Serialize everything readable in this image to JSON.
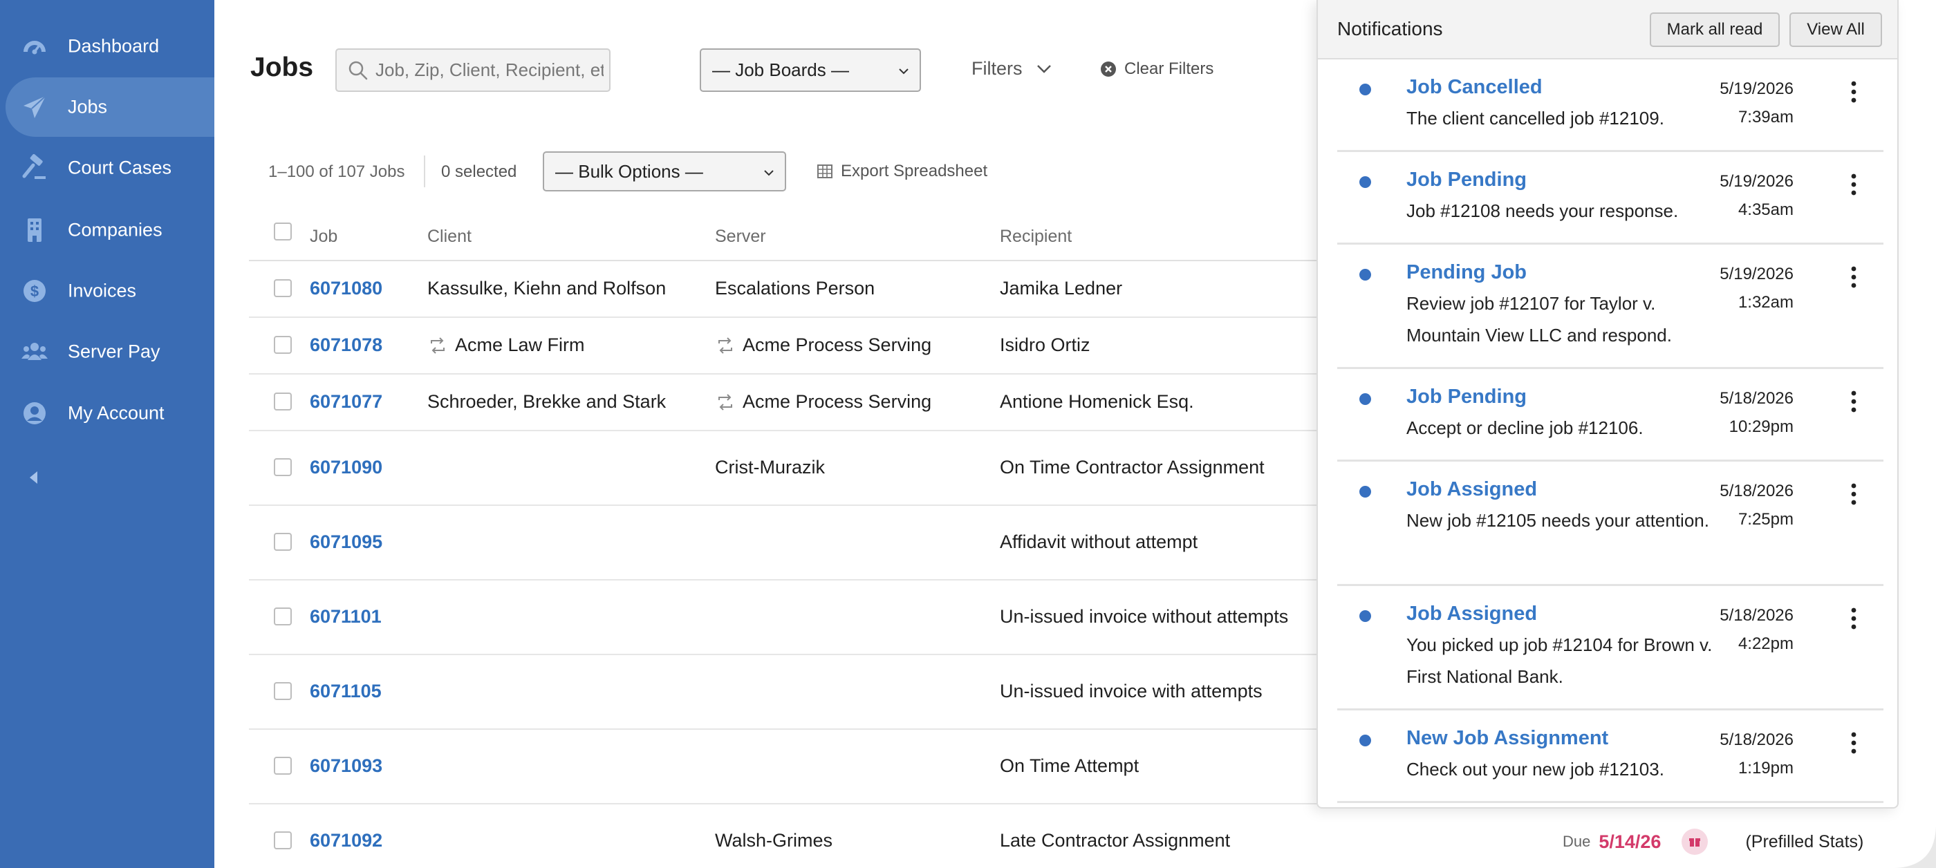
{
  "sidebar": {
    "items": [
      {
        "label": "Dashboard",
        "icon": "dashboard-gauge-icon",
        "active": false
      },
      {
        "label": "Jobs",
        "icon": "paper-plane-icon",
        "active": true
      },
      {
        "label": "Court Cases",
        "icon": "gavel-icon",
        "active": false
      },
      {
        "label": "Companies",
        "icon": "building-icon",
        "active": false
      },
      {
        "label": "Invoices",
        "icon": "dollar-coin-icon",
        "active": false
      },
      {
        "label": "Server Pay",
        "icon": "users-group-icon",
        "active": false
      },
      {
        "label": "My Account",
        "icon": "user-circle-icon",
        "active": false
      }
    ],
    "collapse_icon": "caret-left-icon"
  },
  "header": {
    "title": "Jobs",
    "search_placeholder": "Job, Zip, Client, Recipient, etc.",
    "job_boards_label": "— Job Boards —",
    "filters_label": "Filters",
    "clear_filters_label": "Clear Filters"
  },
  "toolbar": {
    "job_count": "1–100 of 107 Jobs",
    "selected_count": "0 selected",
    "bulk_options_label": "— Bulk Options —",
    "export_label": "Export Spreadsheet"
  },
  "table": {
    "columns": [
      "Job",
      "Client",
      "Server",
      "Recipient"
    ],
    "rows": [
      {
        "job": "6071080",
        "client": "Kassulke, Kiehn and Rolfson",
        "client_repeat": false,
        "server": "Escalations Person",
        "server_repeat": false,
        "recipient": "Jamika Ledner"
      },
      {
        "job": "6071078",
        "client": "Acme Law Firm",
        "client_repeat": true,
        "server": "Acme Process Serving",
        "server_repeat": true,
        "recipient": "Isidro Ortiz"
      },
      {
        "job": "6071077",
        "client": "Schroeder, Brekke and Stark",
        "client_repeat": false,
        "server": "Acme Process Serving",
        "server_repeat": true,
        "recipient": "Antione Homenick Esq."
      },
      {
        "job": "6071090",
        "client": "",
        "client_repeat": false,
        "server": "Crist-Murazik",
        "server_repeat": false,
        "recipient": "On Time Contractor Assignment"
      },
      {
        "job": "6071095",
        "client": "",
        "client_repeat": false,
        "server": "",
        "server_repeat": false,
        "recipient": "Affidavit without attempt"
      },
      {
        "job": "6071101",
        "client": "",
        "client_repeat": false,
        "server": "",
        "server_repeat": false,
        "recipient": "Un-issued invoice without attempts"
      },
      {
        "job": "6071105",
        "client": "",
        "client_repeat": false,
        "server": "",
        "server_repeat": false,
        "recipient": "Un-issued invoice with attempts"
      },
      {
        "job": "6071093",
        "client": "",
        "client_repeat": false,
        "server": "",
        "server_repeat": false,
        "recipient": "On Time Attempt"
      },
      {
        "job": "6071092",
        "client": "",
        "client_repeat": false,
        "server": "Walsh-Grimes",
        "server_repeat": false,
        "recipient": "Late Contractor Assignment",
        "due_label": "Due",
        "due_date": "5/14/26",
        "extra": "(Prefilled Stats)"
      }
    ]
  },
  "notifications": {
    "title": "Notifications",
    "mark_all_read_label": "Mark all read",
    "view_all_label": "View All",
    "items": [
      {
        "title": "Job Cancelled",
        "body": "The client cancelled job #12109.",
        "date": "5/19/2026",
        "time": "7:39am",
        "unread": true
      },
      {
        "title": "Job Pending",
        "body": "Job #12108 needs your response.",
        "date": "5/19/2026",
        "time": "4:35am",
        "unread": true
      },
      {
        "title": "Pending Job",
        "body": "Review job #12107 for Taylor v. Mountain View LLC and respond.",
        "date": "5/19/2026",
        "time": "1:32am",
        "unread": true
      },
      {
        "title": "Job Pending",
        "body": "Accept or decline job #12106.",
        "date": "5/18/2026",
        "time": "10:29pm",
        "unread": true
      },
      {
        "title": "Job Assigned",
        "body": "New job #12105 needs your attention.",
        "date": "5/18/2026",
        "time": "7:25pm",
        "unread": true
      },
      {
        "title": "Job Assigned",
        "body": "You picked up job #12104 for Brown v. First National Bank.",
        "date": "5/18/2026",
        "time": "4:22pm",
        "unread": true
      },
      {
        "title": "New Job Assignment",
        "body": "Check out your new job #12103.",
        "date": "5/18/2026",
        "time": "1:19pm",
        "unread": true
      }
    ]
  },
  "colors": {
    "sidebar_bg": "#3a6cb4",
    "sidebar_active": "#5483c3",
    "link_blue": "#2e6fbd",
    "due_red": "#d33a6a",
    "unread_dot": "#3770c0"
  }
}
